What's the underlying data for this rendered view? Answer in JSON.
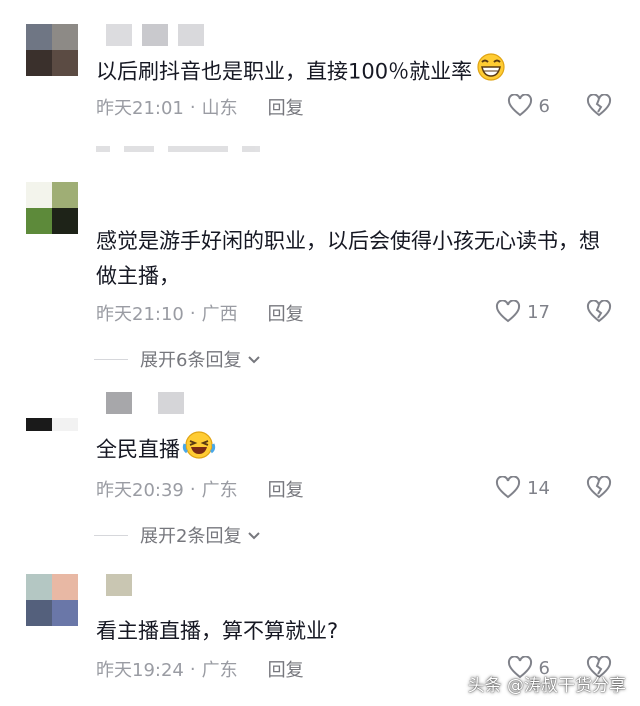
{
  "comments": [
    {
      "text": "以后刷抖音也是职业，直接100％就业率",
      "emoji": "grinning-face-emoji",
      "time": "昨天21:01",
      "separator": "·",
      "location": "山东",
      "reply": "回复",
      "likes": "6"
    },
    {
      "text": "感觉是游手好闲的职业，以后会使得小孩无心读书，想做主播，",
      "time": "昨天21:10",
      "separator": "·",
      "location": "广西",
      "reply": "回复",
      "likes": "17",
      "expand": "展开6条回复"
    },
    {
      "text": "全民直播",
      "emoji": "laughing-tears-emoji",
      "time": "昨天20:39",
      "separator": "·",
      "location": "广东",
      "reply": "回复",
      "likes": "14",
      "expand": "展开2条回复"
    },
    {
      "text": "看主播直播，算不算就业?",
      "time": "昨天19:24",
      "separator": "·",
      "location": "广东",
      "reply": "回复",
      "likes": "6"
    }
  ],
  "watermark": "头条 @涛叔干货分享",
  "icons": {
    "like": "heart-outline-icon",
    "dislike": "broken-heart-icon",
    "expand": "chevron-down-icon"
  },
  "colors": {
    "text": "#161823",
    "meta": "#9a9ca3",
    "icon": "#80828a"
  }
}
